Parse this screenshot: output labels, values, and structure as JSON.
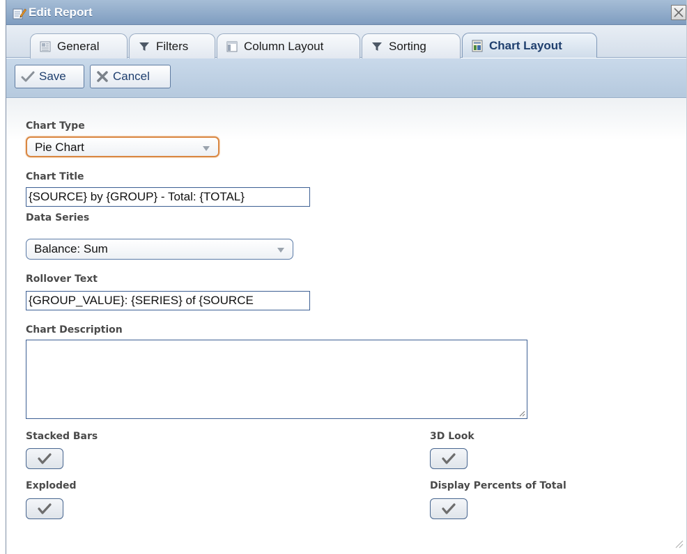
{
  "window": {
    "title": "Edit Report"
  },
  "tabs": [
    {
      "label": "General",
      "icon": "general-icon",
      "active": false
    },
    {
      "label": "Filters",
      "icon": "filter-icon",
      "active": false
    },
    {
      "label": "Column Layout",
      "icon": "column-layout-icon",
      "active": false
    },
    {
      "label": "Sorting",
      "icon": "filter-icon",
      "active": false
    },
    {
      "label": "Chart Layout",
      "icon": "chart-layout-icon",
      "active": true
    }
  ],
  "toolbar": {
    "save_label": "Save",
    "cancel_label": "Cancel"
  },
  "form": {
    "chart_type": {
      "label": "Chart Type",
      "value": "Pie Chart"
    },
    "chart_title": {
      "label": "Chart Title",
      "value": "{SOURCE} by {GROUP} - Total: {TOTAL}"
    },
    "data_series": {
      "label": "Data Series",
      "value": "Balance: Sum"
    },
    "rollover_text": {
      "label": "Rollover Text",
      "value": "{GROUP_VALUE}: {SERIES} of {SOURCE"
    },
    "chart_description": {
      "label": "Chart Description",
      "value": ""
    },
    "stacked_bars": {
      "label": "Stacked Bars",
      "checked": true
    },
    "three_d_look": {
      "label": "3D Look",
      "checked": true
    },
    "exploded": {
      "label": "Exploded",
      "checked": true
    },
    "display_percents": {
      "label": "Display Percents of Total",
      "checked": true
    }
  },
  "colors": {
    "titlebar": "#8aa7c8",
    "active_tab_text": "#1f3f6e",
    "focus_border": "#d98742",
    "field_border": "#3c5f93"
  }
}
